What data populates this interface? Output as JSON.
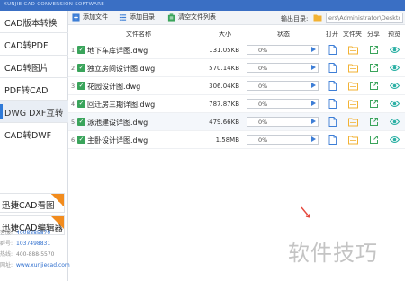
{
  "app": {
    "brand": "XUNJIE CAD CONVERSION SOFTWARE"
  },
  "sidebar": {
    "items": [
      {
        "label": "CAD版本转换",
        "active": false
      },
      {
        "label": "CAD转PDF",
        "active": false
      },
      {
        "label": "CAD转图片",
        "active": false
      },
      {
        "label": "PDF转CAD",
        "active": false
      },
      {
        "label": "DWG DXF互转",
        "active": true
      },
      {
        "label": "CAD转DWF",
        "active": false
      }
    ],
    "promos": [
      {
        "label": "迅捷CAD看图"
      },
      {
        "label": "迅捷CAD编辑器"
      }
    ],
    "contact": [
      {
        "key": "客服:",
        "value": "4008885870"
      },
      {
        "key": "群号:",
        "value": "1037498831"
      },
      {
        "key": "热线:",
        "value": "400-888-5570"
      },
      {
        "key": "网址:",
        "value": "www.xunjiecad.com"
      }
    ]
  },
  "toolbar": {
    "add_file": "添加文件",
    "add_folder": "添加目录",
    "clear_list": "清空文件列表",
    "output_label": "输出目录:",
    "output_path": "ers\\Administrator\\Desktop"
  },
  "table": {
    "headers": {
      "name": "文件名称",
      "size": "大小",
      "status": "状态",
      "open": "打开",
      "folder": "文件夹",
      "share": "分享",
      "preview": "预览"
    },
    "rows": [
      {
        "num": "1",
        "name": "地下车库详图.dwg",
        "size": "131.05KB",
        "progress": "0%",
        "progress_value": 0
      },
      {
        "num": "2",
        "name": "独立房间设计图.dwg",
        "size": "570.14KB",
        "progress": "0%",
        "progress_value": 0
      },
      {
        "num": "3",
        "name": "花园设计图.dwg",
        "size": "306.04KB",
        "progress": "0%",
        "progress_value": 0
      },
      {
        "num": "4",
        "name": "回迁房三期详图.dwg",
        "size": "787.87KB",
        "progress": "0%",
        "progress_value": 0
      },
      {
        "num": "5",
        "name": "泳池建设详图.dwg",
        "size": "479.66KB",
        "progress": "0%",
        "progress_value": 0
      },
      {
        "num": "6",
        "name": "主卧设计详图.dwg",
        "size": "1.58MB",
        "progress": "0%",
        "progress_value": 0
      }
    ]
  },
  "watermark": "软件技巧",
  "colors": {
    "accent": "#2f7ad8",
    "progress_fill": "#5fa8e8",
    "check": "#3aa45b",
    "folder": "#f2b233",
    "share": "#3aa45b",
    "preview": "#2bb0a4",
    "open": "#3d7ed6"
  }
}
